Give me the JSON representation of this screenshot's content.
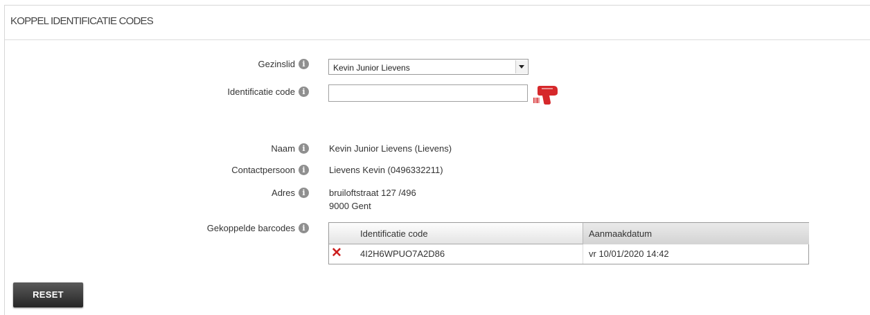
{
  "panel": {
    "title": "KOPPEL IDENTIFICATIE CODES"
  },
  "form": {
    "gezinslid_label": "Gezinslid",
    "gezinslid_value": "Kevin Junior Lievens",
    "code_label": "Identificatie code",
    "code_value": "",
    "code_placeholder": ""
  },
  "details": {
    "naam_label": "Naam",
    "naam_value": "Kevin Junior Lievens (Lievens)",
    "contact_label": "Contactpersoon",
    "contact_value": "Lievens Kevin (0496332211)",
    "adres_label": "Adres",
    "adres_line1": "bruiloftstraat 127 /496",
    "adres_line2": "9000 Gent"
  },
  "barcodes": {
    "label": "Gekoppelde barcodes",
    "headers": {
      "code": "Identificatie code",
      "date": "Aanmaakdatum"
    },
    "rows": [
      {
        "delete_icon": "delete-x-icon",
        "code": "4I2H6WPUO7A2D86",
        "date": "vr 10/01/2020 14:42"
      }
    ]
  },
  "icons": {
    "info": "i",
    "delete": "✕",
    "scanner": "barcode-scanner-icon"
  },
  "colors": {
    "accent_red": "#cc1f1f",
    "button_dark": "#333333",
    "info_gray": "#8f8f8f"
  },
  "actions": {
    "reset_label": "RESET"
  }
}
